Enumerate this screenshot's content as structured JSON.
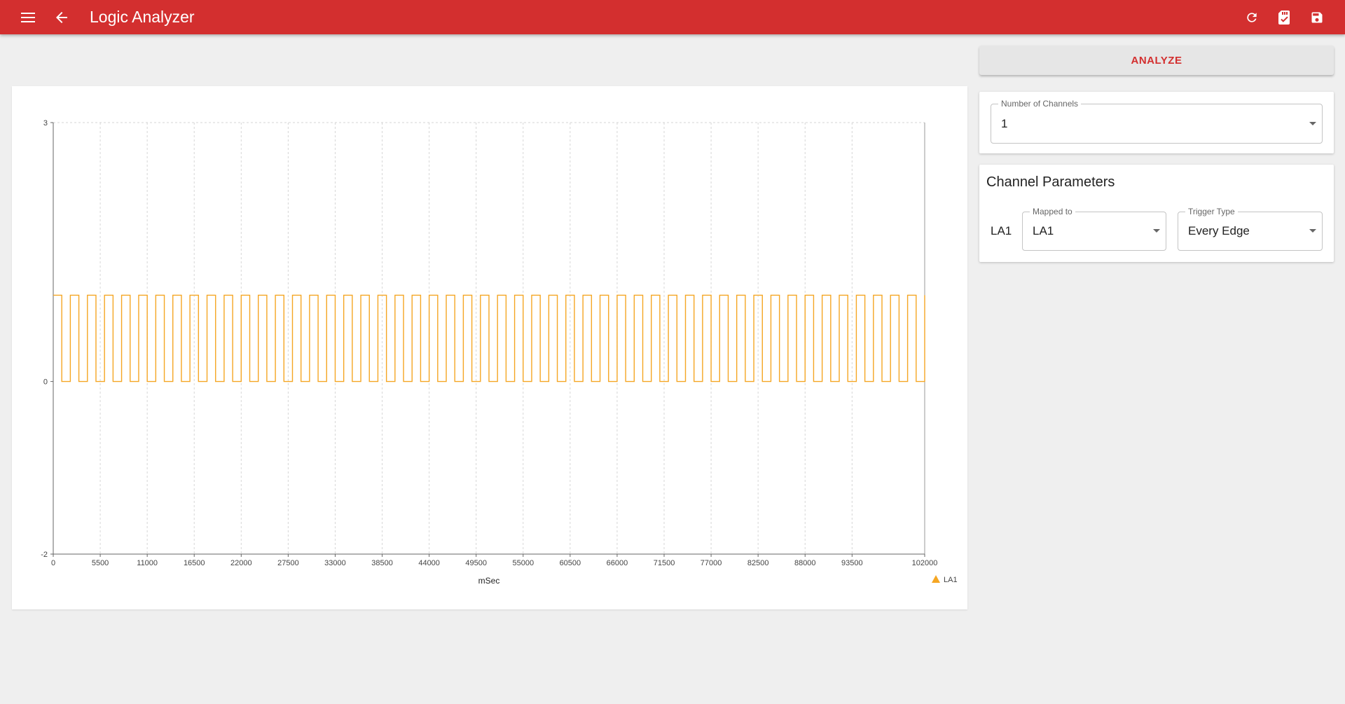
{
  "app": {
    "title": "Logic Analyzer"
  },
  "toolbar": {
    "menu_icon": "menu-icon",
    "back_icon": "arrow-left-icon",
    "refresh_icon": "refresh-icon",
    "sd_card_icon": "sd-card-check-icon",
    "save_icon": "save-icon"
  },
  "colors": {
    "appbar": "#d32f2f",
    "accent": "#d32f2f",
    "signal": "#f5a623",
    "background": "#efefef"
  },
  "controls": {
    "analyze_label": "ANALYZE",
    "number_of_channels": {
      "label": "Number of Channels",
      "value": "1"
    }
  },
  "channel_parameters": {
    "heading": "Channel Parameters",
    "channels": [
      {
        "name": "LA1",
        "mapped_to_label": "Mapped to",
        "mapped_to": "LA1",
        "trigger_type_label": "Trigger Type",
        "trigger_type": "Every Edge"
      }
    ]
  },
  "chart_data": {
    "type": "line",
    "title": "",
    "xlabel": "mSec",
    "ylabel": "",
    "xlim": [
      0,
      102000
    ],
    "ylim": [
      -2,
      3
    ],
    "x_ticks": [
      "0",
      "5500",
      "11000",
      "16500",
      "22000",
      "27500",
      "33000",
      "38500",
      "44000",
      "49500",
      "55000",
      "60500",
      "66000",
      "71500",
      "77000",
      "82500",
      "88000",
      "93500",
      "102000"
    ],
    "y_ticks": [
      "-2",
      "0",
      "3"
    ],
    "grid": true,
    "legend_position": "bottom-right",
    "series": [
      {
        "name": "LA1",
        "color": "#f5a623",
        "waveform": "square",
        "high": 1,
        "low": 0,
        "period": 2000,
        "start_level": 1,
        "x_start": 0,
        "x_end": 102000
      }
    ]
  }
}
